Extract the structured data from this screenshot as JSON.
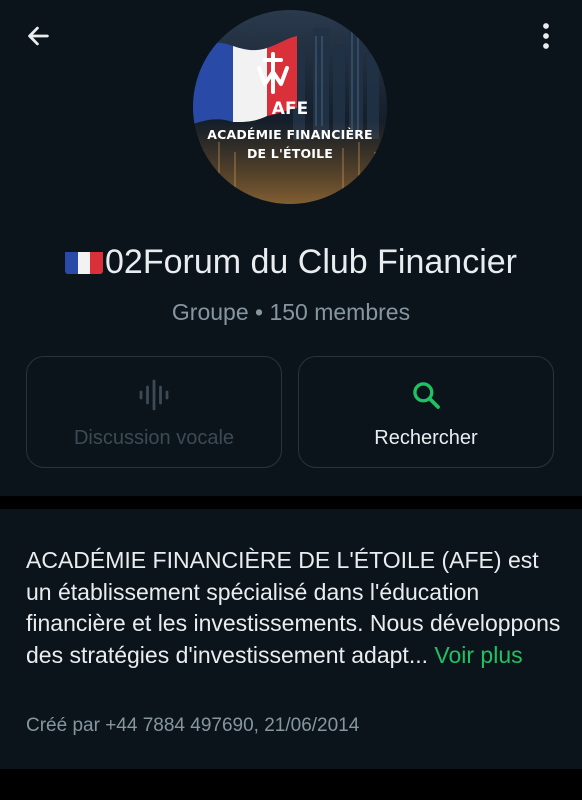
{
  "header": {
    "back_icon": "arrow-left-icon",
    "menu_icon": "more-vertical-icon"
  },
  "avatar": {
    "line1": "ACADÉMIE FINANCIÈRE",
    "line2": "DE L'ÉTOILE",
    "logo_text": "AFE"
  },
  "group": {
    "flag_icon": "france-flag-emoji",
    "title": "02Forum du Club Financier",
    "subtitle": "Groupe • 150 membres"
  },
  "actions": {
    "voice_label": "Discussion vocale",
    "voice_icon": "audio-wave-icon",
    "search_label": "Rechercher",
    "search_icon": "search-icon"
  },
  "description": {
    "text": "ACADÉMIE FINANCIÈRE DE L'ÉTOILE (AFE) est un établissement spécialisé dans l'éducation financière et les investissements. Nous développons des stratégies d'investissement adapt...",
    "see_more": "Voir plus",
    "created": "Créé par +44 7884 497690, 21/06/2014"
  },
  "colors": {
    "background": "#0b141a",
    "separator": "#000000",
    "accent": "#21c063",
    "secondary_text": "#8696a0",
    "primary_text": "#e9edef"
  }
}
